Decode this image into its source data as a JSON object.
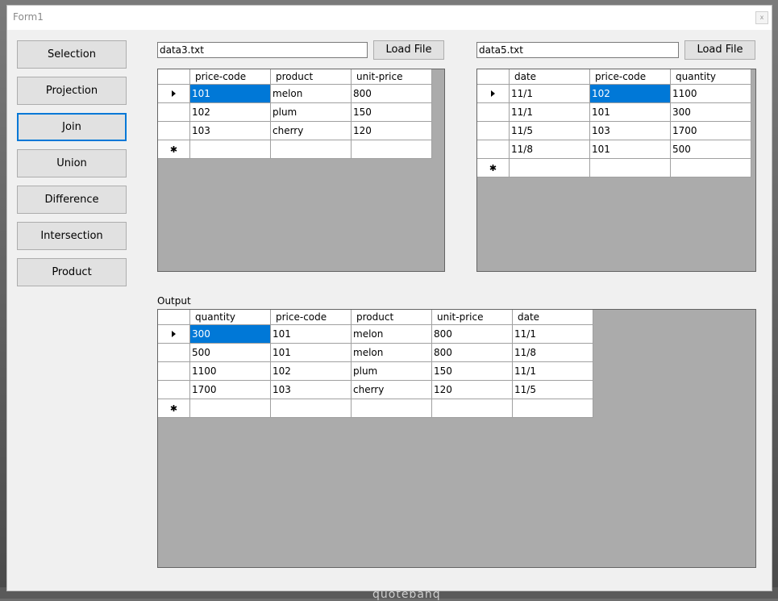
{
  "window": {
    "title": "Form1",
    "close_glyph": "x"
  },
  "background": {
    "caption": "quotebanq"
  },
  "sidebar": {
    "buttons": [
      {
        "label": "Selection"
      },
      {
        "label": "Projection"
      },
      {
        "label": "Join",
        "active": true
      },
      {
        "label": "Union"
      },
      {
        "label": "Difference"
      },
      {
        "label": "Intersection"
      },
      {
        "label": "Product"
      }
    ]
  },
  "left_panel": {
    "file": "data3.txt",
    "load_label": "Load File",
    "columns": [
      "price-code",
      "product",
      "unit-price"
    ],
    "rows": [
      [
        "101",
        "melon",
        "800"
      ],
      [
        "102",
        "plum",
        "150"
      ],
      [
        "103",
        "cherry",
        "120"
      ]
    ]
  },
  "right_panel": {
    "file": "data5.txt",
    "load_label": "Load File",
    "columns": [
      "date",
      "price-code",
      "quantity"
    ],
    "rows": [
      [
        "11/1",
        "102",
        "1100"
      ],
      [
        "11/1",
        "101",
        "300"
      ],
      [
        "11/5",
        "103",
        "1700"
      ],
      [
        "11/8",
        "101",
        "500"
      ]
    ]
  },
  "output": {
    "label": "Output",
    "columns": [
      "quantity",
      "price-code",
      "product",
      "unit-price",
      "date"
    ],
    "rows": [
      [
        "300",
        "101",
        "melon",
        "800",
        "11/1"
      ],
      [
        "500",
        "101",
        "melon",
        "800",
        "11/8"
      ],
      [
        "1100",
        "102",
        "plum",
        "150",
        "11/1"
      ],
      [
        "1700",
        "103",
        "cherry",
        "120",
        "11/5"
      ]
    ]
  },
  "icons": {
    "current_row": "row-pointer-icon",
    "new_row": "new-row-icon"
  },
  "colors": {
    "selection": "#0078d7",
    "grid_bg": "#ababab"
  }
}
